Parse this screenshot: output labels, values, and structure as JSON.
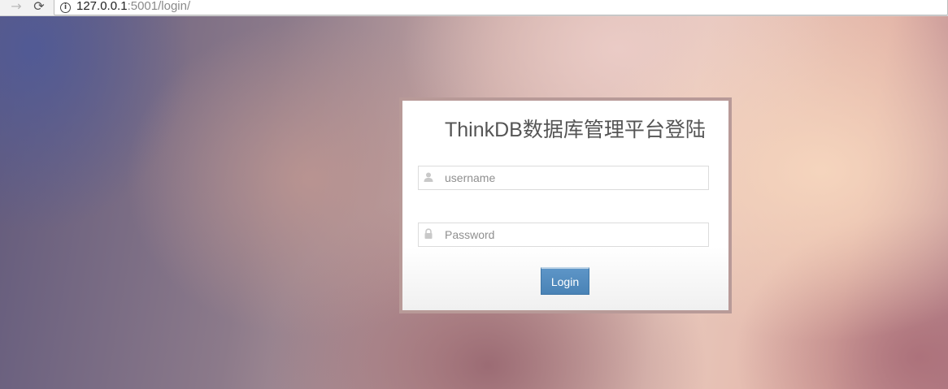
{
  "browser": {
    "url_host": "127.0.0.1",
    "url_rest": ":5001/login/",
    "forward_glyph": "→",
    "reload_glyph": "⟳",
    "info_glyph": "i"
  },
  "login": {
    "title": "ThinkDB数据库管理平台登陆",
    "username_placeholder": "username",
    "password_placeholder": "Password",
    "button_label": "Login"
  },
  "icons": {
    "username": "user-icon",
    "password": "lock-icon"
  },
  "colors": {
    "button": "#4a83b6",
    "panel_border": "#b89a98",
    "title_text": "#555555"
  }
}
